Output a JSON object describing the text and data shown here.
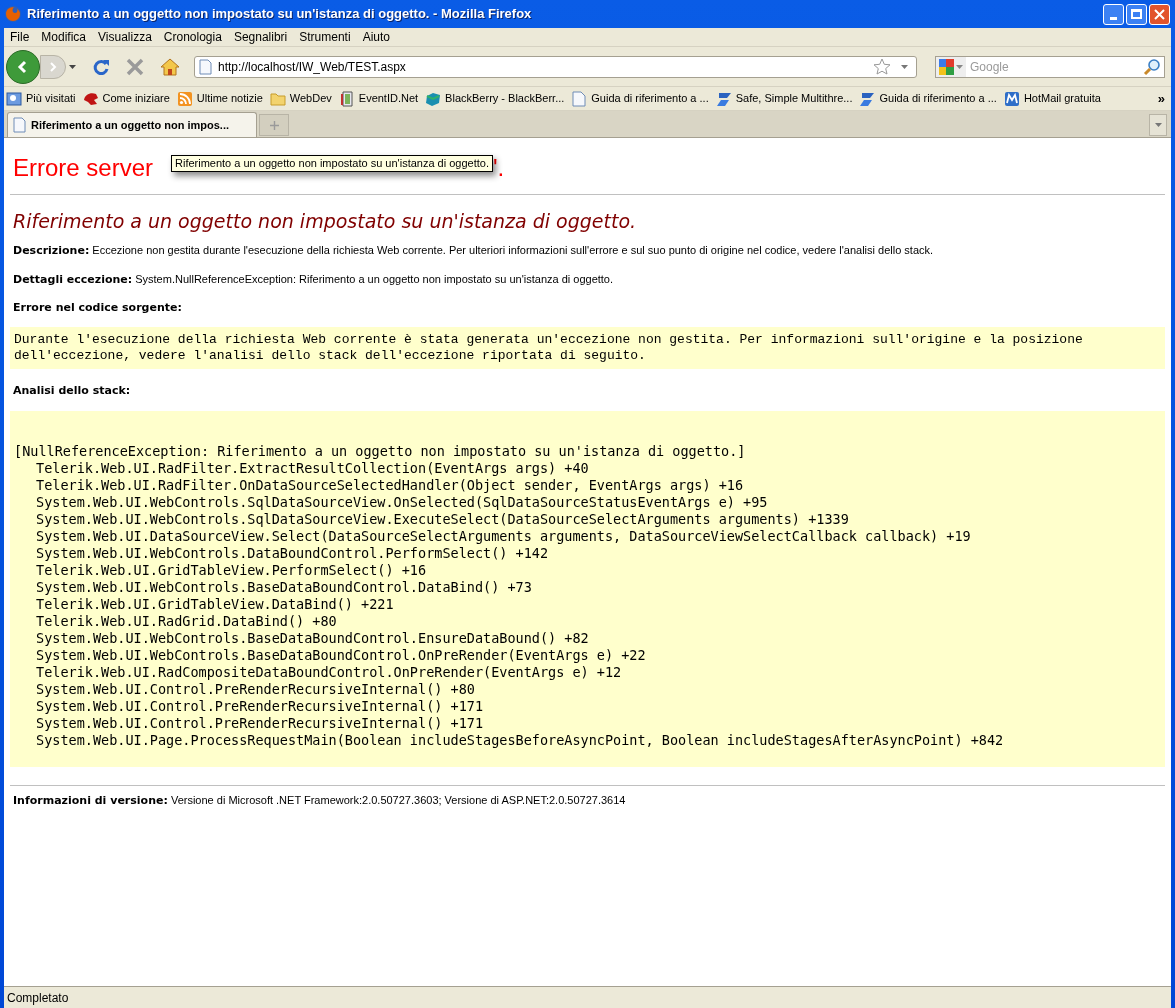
{
  "window": {
    "title": "Riferimento a un oggetto non impostato su un'istanza di oggetto. - Mozilla Firefox"
  },
  "menu": [
    "File",
    "Modifica",
    "Visualizza",
    "Cronologia",
    "Segnalibri",
    "Strumenti",
    "Aiuto"
  ],
  "toolbar": {
    "url": "http://localhost/IW_Web/TEST.aspx",
    "search_placeholder": "Google"
  },
  "bookmarks": [
    {
      "label": "Più visitati",
      "kind": "search"
    },
    {
      "label": "Come iniziare",
      "kind": "red"
    },
    {
      "label": "Ultime notizie",
      "kind": "rss"
    },
    {
      "label": "WebDev",
      "kind": "folder"
    },
    {
      "label": "EventID.Net",
      "kind": "book"
    },
    {
      "label": "BlackBerry - BlackBerr...",
      "kind": "bb"
    },
    {
      "label": "Guida di riferimento a ...",
      "kind": "page"
    },
    {
      "label": "Safe, Simple Multithre...",
      "kind": "blue"
    },
    {
      "label": "Guida di riferimento a ...",
      "kind": "blue"
    },
    {
      "label": "HotMail gratuita",
      "kind": "m"
    }
  ],
  "bookmarks_overflow": "»",
  "tabs": [
    {
      "label": "Riferimento a un oggetto non impos...",
      "selected": true
    }
  ],
  "tooltip": "Riferimento a un oggetto non impostato su un'istanza di oggetto.",
  "page": {
    "heading": {
      "start": "Errore server",
      "end": "'."
    },
    "subheading": "Riferimento a un oggetto non impostato su un'istanza di oggetto.",
    "description": {
      "label": "Descrizione:",
      "text": "Eccezione non gestita durante l'esecuzione della richiesta Web corrente. Per ulteriori informazioni sull'errore e sul suo punto di origine nel codice, vedere l'analisi dello stack."
    },
    "details": {
      "label": "Dettagli eccezione:",
      "text": "System.NullReferenceException: Riferimento a un oggetto non impostato su un'istanza di oggetto."
    },
    "source_error": {
      "label": "Errore nel codice sorgente:",
      "text": "Durante l'esecuzione della richiesta Web corrente è stata generata un'eccezione non gestita. Per informazioni sull'origine e la posizione dell'eccezione, vedere l'analisi dello stack dell'eccezione riportata di seguito."
    },
    "stack": {
      "label": "Analisi dello stack:",
      "exception": "[NullReferenceException: Riferimento a un oggetto non impostato su un'istanza di oggetto.]",
      "frames": [
        "Telerik.Web.UI.RadFilter.ExtractResultCollection(EventArgs args) +40",
        "Telerik.Web.UI.RadFilter.OnDataSourceSelectedHandler(Object sender, EventArgs args) +16",
        "System.Web.UI.WebControls.SqlDataSourceView.OnSelected(SqlDataSourceStatusEventArgs e) +95",
        "System.Web.UI.WebControls.SqlDataSourceView.ExecuteSelect(DataSourceSelectArguments arguments) +1339",
        "System.Web.UI.DataSourceView.Select(DataSourceSelectArguments arguments, DataSourceViewSelectCallback callback) +19",
        "System.Web.UI.WebControls.DataBoundControl.PerformSelect() +142",
        "Telerik.Web.UI.GridTableView.PerformSelect() +16",
        "System.Web.UI.WebControls.BaseDataBoundControl.DataBind() +73",
        "Telerik.Web.UI.GridTableView.DataBind() +221",
        "Telerik.Web.UI.RadGrid.DataBind() +80",
        "System.Web.UI.WebControls.BaseDataBoundControl.EnsureDataBound() +82",
        "System.Web.UI.WebControls.BaseDataBoundControl.OnPreRender(EventArgs e) +22",
        "Telerik.Web.UI.RadCompositeDataBoundControl.OnPreRender(EventArgs e) +12",
        "System.Web.UI.Control.PreRenderRecursiveInternal() +80",
        "System.Web.UI.Control.PreRenderRecursiveInternal() +171",
        "System.Web.UI.Control.PreRenderRecursiveInternal() +171",
        "System.Web.UI.Page.ProcessRequestMain(Boolean includeStagesBeforeAsyncPoint, Boolean includeStagesAfterAsyncPoint) +842"
      ]
    },
    "version": {
      "label": "Informazioni di versione:",
      "text": "Versione di Microsoft .NET Framework:2.0.50727.3603; Versione di ASP.NET:2.0.50727.3614"
    }
  },
  "status_bar": "Completato"
}
